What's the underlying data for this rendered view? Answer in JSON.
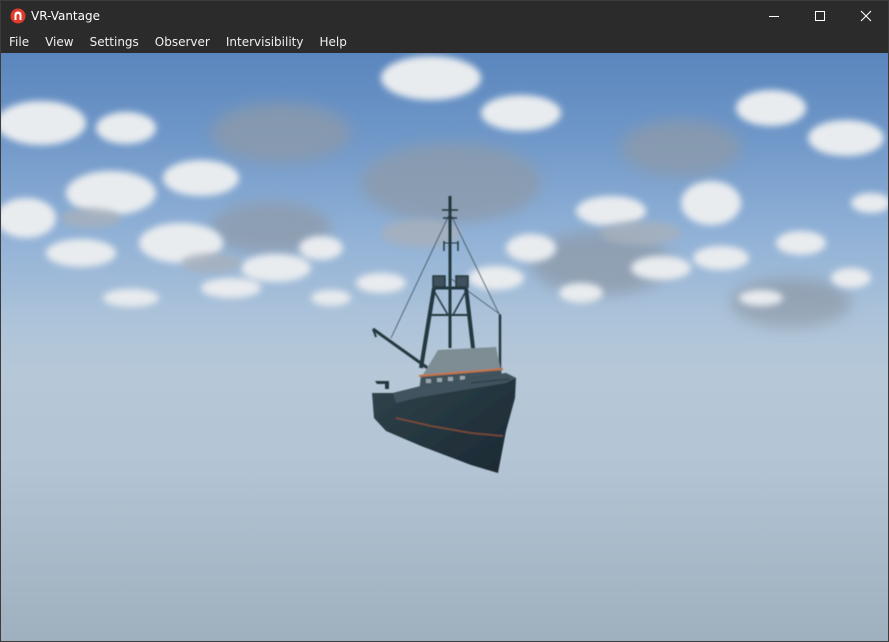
{
  "window": {
    "title": "VR-Vantage",
    "icon": "vr-vantage-logo-icon",
    "controls": [
      "minimize-icon",
      "maximize-icon",
      "close-icon"
    ]
  },
  "menu": {
    "file": "File",
    "view": "View",
    "settings": "Settings",
    "observer": "Observer",
    "intervisibility": "Intervisibility",
    "help": "Help"
  },
  "scene": {
    "subject": "fishing-boat",
    "sky_color": "#5a86bd",
    "haze_color": "#a3b4c3",
    "hull_color": "#1f3038"
  }
}
